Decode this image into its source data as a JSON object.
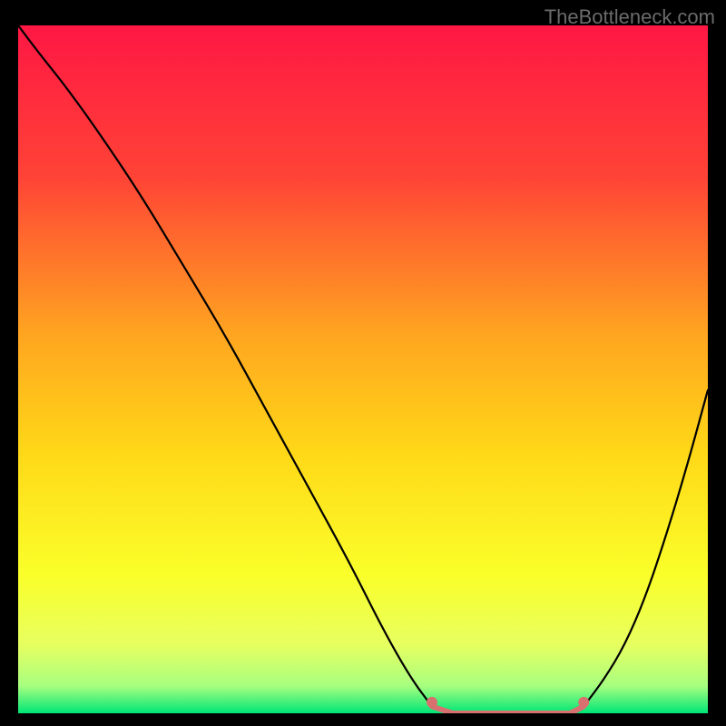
{
  "watermark": "TheBottleneck.com",
  "chart_data": {
    "type": "line",
    "title": "",
    "xlabel": "",
    "ylabel": "",
    "xlim": [
      0,
      1
    ],
    "ylim": [
      0,
      1
    ],
    "series": [
      {
        "name": "left-curve",
        "x": [
          0.0,
          0.03,
          0.07,
          0.12,
          0.18,
          0.24,
          0.3,
          0.36,
          0.42,
          0.48,
          0.53,
          0.57,
          0.6
        ],
        "values": [
          1.0,
          0.96,
          0.91,
          0.84,
          0.75,
          0.65,
          0.55,
          0.44,
          0.33,
          0.22,
          0.12,
          0.05,
          0.01
        ]
      },
      {
        "name": "right-curve",
        "x": [
          0.82,
          0.85,
          0.88,
          0.91,
          0.94,
          0.97,
          1.0
        ],
        "values": [
          0.01,
          0.05,
          0.1,
          0.17,
          0.26,
          0.36,
          0.47
        ]
      },
      {
        "name": "optimal-band",
        "x": [
          0.6,
          0.63,
          0.7,
          0.77,
          0.8,
          0.82
        ],
        "values": [
          0.01,
          0.0,
          0.0,
          0.0,
          0.0,
          0.01
        ]
      }
    ],
    "gradient_stops": [
      {
        "offset": 0.0,
        "color": "#ff1744"
      },
      {
        "offset": 0.22,
        "color": "#ff4336"
      },
      {
        "offset": 0.45,
        "color": "#ffa520"
      },
      {
        "offset": 0.62,
        "color": "#ffd817"
      },
      {
        "offset": 0.8,
        "color": "#faff2a"
      },
      {
        "offset": 0.9,
        "color": "#e7ff60"
      },
      {
        "offset": 0.96,
        "color": "#a8ff80"
      },
      {
        "offset": 1.0,
        "color": "#00e676"
      }
    ],
    "marker_color": "#d97070",
    "curve_color": "#000000"
  }
}
